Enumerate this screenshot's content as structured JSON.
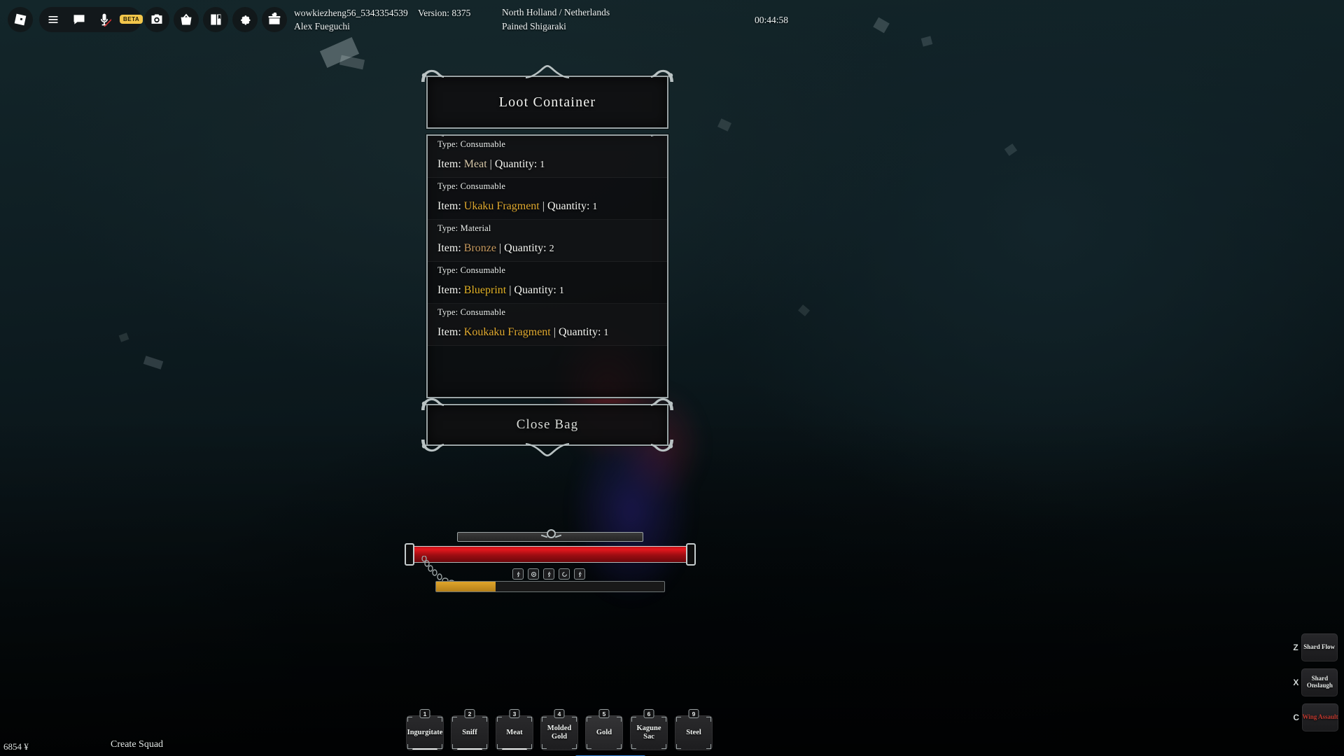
{
  "topbar": {
    "icons": [
      {
        "name": "roblox-logo-icon",
        "label": "Roblox"
      },
      {
        "name": "menu-icon",
        "label": "Menu"
      },
      {
        "name": "chat-icon",
        "label": "Chat"
      },
      {
        "name": "microphone-muted-icon",
        "label": "Microphone Muted"
      },
      {
        "name": "camera-icon",
        "label": "Screenshot"
      },
      {
        "name": "shop-basket-icon",
        "label": "Shop"
      },
      {
        "name": "catalog-book-icon",
        "label": "Inventory"
      },
      {
        "name": "gear-icon",
        "label": "Settings"
      },
      {
        "name": "gift-icon",
        "label": "Rewards"
      }
    ],
    "beta_badge": "BETA",
    "username": "wowkiezheng56_5343354539",
    "display_name": "Alex Fueguchi",
    "version_label": "Version: 8375",
    "region": "North Holland / Netherlands",
    "server_name": "Pained Shigaraki",
    "timer": "00:44:58"
  },
  "dialog": {
    "title": "Loot Container",
    "close_label": "Close Bag",
    "labels": {
      "type": "Type:",
      "item": "Item:",
      "quantity": "Quantity:",
      "separator": "|"
    },
    "items": [
      {
        "type": "Consumable",
        "name": "Meat",
        "quantity": "1",
        "color": "#d6c7a8"
      },
      {
        "type": "Consumable",
        "name": "Ukaku Fragment",
        "quantity": "1",
        "color": "#e0a92f"
      },
      {
        "type": "Material",
        "name": "Bronze",
        "quantity": "2",
        "color": "#c79a5e"
      },
      {
        "type": "Consumable",
        "name": "Blueprint",
        "quantity": "1",
        "color": "#e2b226"
      },
      {
        "type": "Consumable",
        "name": "Koukaku Fragment",
        "quantity": "1",
        "color": "#e0a92f"
      }
    ]
  },
  "hud": {
    "hotbar": [
      {
        "key": "1",
        "label": "Ingurgitate"
      },
      {
        "key": "2",
        "label": "Sniff"
      },
      {
        "key": "3",
        "label": "Meat"
      },
      {
        "key": "4",
        "label": "Molded Gold"
      },
      {
        "key": "5",
        "label": "Gold"
      },
      {
        "key": "6",
        "label": "Kagune Sac"
      },
      {
        "key": "9",
        "label": "Steel"
      }
    ],
    "abilities": [
      {
        "key": "Z",
        "label": "Shard Flow",
        "locked": false
      },
      {
        "key": "X",
        "label": "Shard Onslaugh",
        "locked": false
      },
      {
        "key": "C",
        "label": "Wing Assault",
        "locked": true
      }
    ],
    "money": "6854 ¥",
    "squad_label": "Create Squad",
    "health_percent": 100,
    "xp_percent": 26
  },
  "colors": {
    "accent_gold": "#e0a92f",
    "health_red": "#c4131a",
    "xp_gold": "#e0a52a",
    "frame_silver": "#9aa4a6"
  }
}
